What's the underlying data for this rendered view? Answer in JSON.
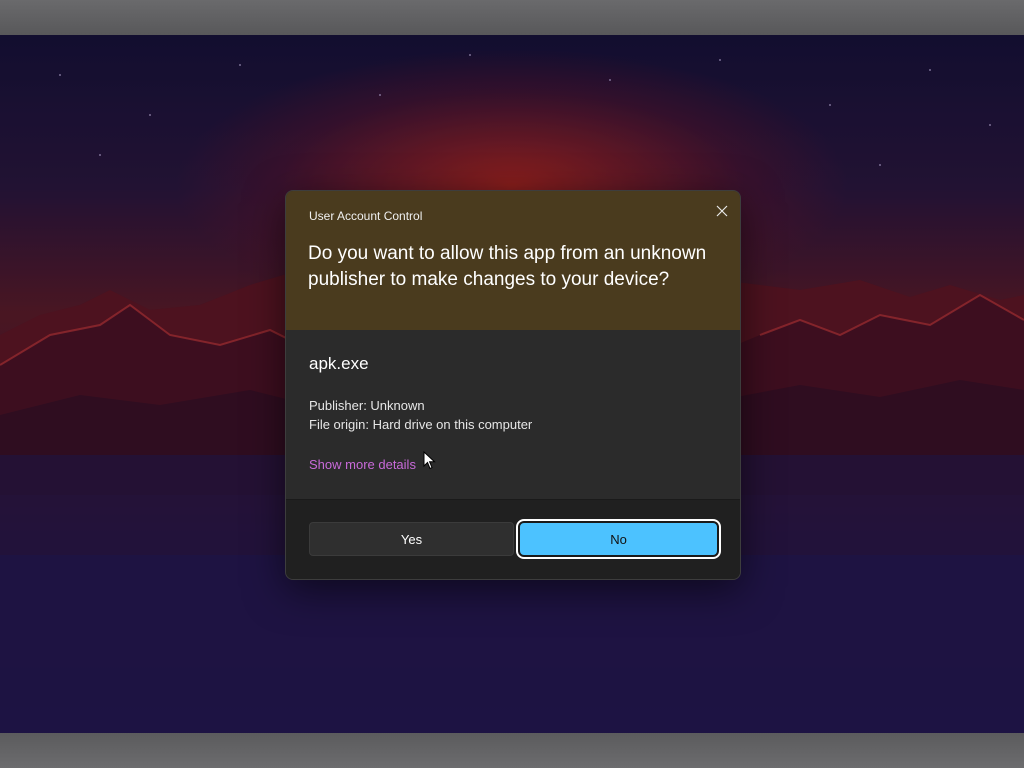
{
  "dialog": {
    "window_title": "User Account Control",
    "question": "Do you want to allow this app from an unknown publisher to make changes to your device?",
    "app_name": "apk.exe",
    "publisher_line": "Publisher: Unknown",
    "origin_line": "File origin: Hard drive on this computer",
    "details_link": "Show more details",
    "yes_label": "Yes",
    "no_label": "No",
    "close_icon": "close-icon"
  },
  "colors": {
    "header_bg": "#4a3b1e",
    "accent": "#4cc2ff",
    "link": "#c86ad9",
    "body_bg": "#2b2b2b"
  }
}
